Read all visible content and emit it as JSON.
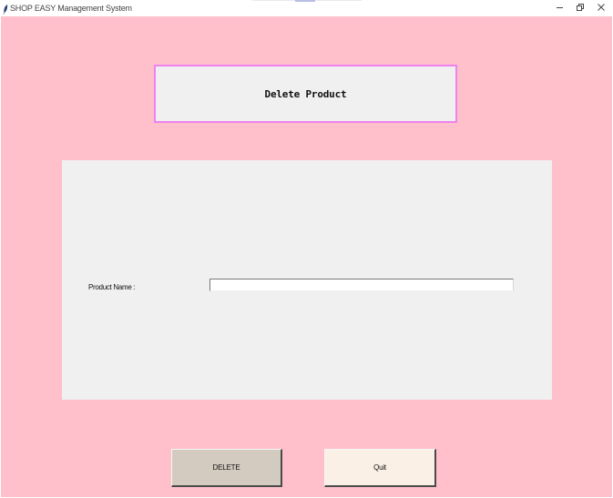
{
  "window": {
    "title": "SHOP EASY Management System",
    "icon": "feather-icon",
    "controls": {
      "minimize_icon": "minimize-icon",
      "restore_icon": "restore-icon",
      "close_icon": "close-icon"
    }
  },
  "header": {
    "title": "Delete Product"
  },
  "form": {
    "product_name_label": "Product Name :",
    "product_name_value": ""
  },
  "buttons": {
    "delete_label": "DELETE",
    "quit_label": "Quit"
  },
  "colors": {
    "background": "#ffc0cb",
    "panel": "#f0f0f0",
    "header_border": "#ee82ee",
    "delete_button": "#d3cbc0",
    "quit_button": "#faf0e6"
  }
}
